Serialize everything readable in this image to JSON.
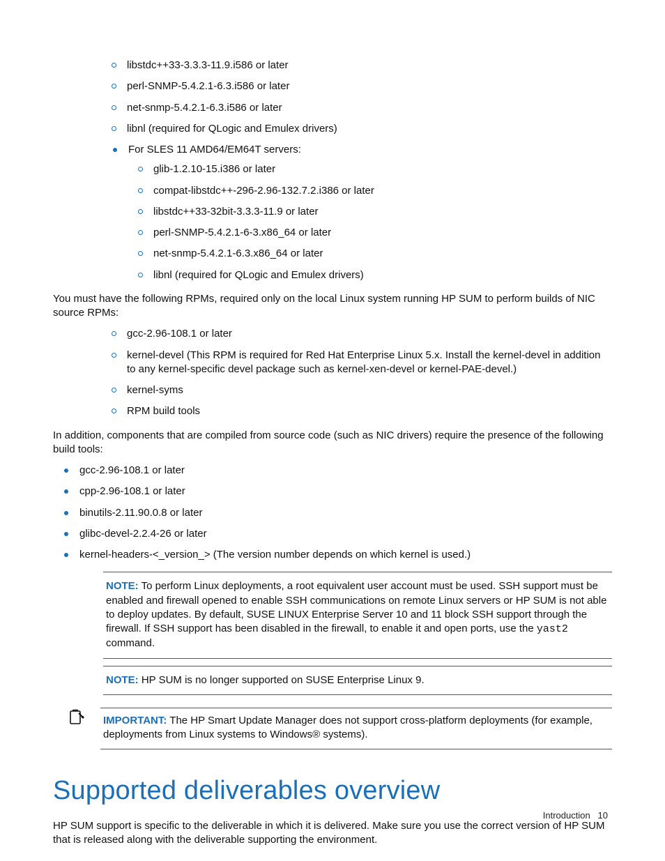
{
  "lists": {
    "circle_a": [
      "libstdc++33-3.3.3-11.9.i586 or later",
      "perl-SNMP-5.4.2.1-6.3.i586 or later",
      "net-snmp-5.4.2.1-6.3.i586 or later",
      "libnl (required for QLogic and Emulex drivers)"
    ],
    "bullet_intro": "For SLES 11 AMD64/EM64T servers:",
    "circle_b": [
      "glib-1.2.10-15.i386 or later",
      "compat-libstdc++-296-2.96-132.7.2.i386 or later",
      "libstdc++33-32bit-3.3.3-11.9 or later",
      "perl-SNMP-5.4.2.1-6-3.x86_64 or later",
      "net-snmp-5.4.2.1-6.3.x86_64 or later",
      "libnl (required for QLogic and Emulex drivers)"
    ],
    "para_rpms": "You must have the following RPMs, required only on the local Linux system running HP SUM to perform builds of NIC source RPMs:",
    "circle_c": [
      "gcc-2.96-108.1 or later",
      "kernel-devel (This RPM is required for Red Hat Enterprise Linux 5.x. Install the kernel-devel in addition to any kernel-specific devel package such as kernel-xen-devel or kernel-PAE-devel.)",
      "kernel-syms",
      "RPM build tools"
    ],
    "para_compiled": "In addition, components that are compiled from source code (such as NIC drivers) require the presence of the following build tools:",
    "bullet_d": [
      "gcc-2.96-108.1 or later",
      "cpp-2.96-108.1 or later",
      "binutils-2.11.90.0.8 or later",
      "glibc-devel-2.2.4-26 or later",
      "kernel-headers-<_version_> (The version number depends on which kernel is used.)"
    ]
  },
  "notes": {
    "note1_label": "NOTE:",
    "note1_body_a": " To perform Linux deployments, a root equivalent user account must be used. SSH support must be enabled and firewall opened to enable SSH communications on remote Linux servers or HP SUM is not able to deploy updates. By default, SUSE LINUX Enterprise Server 10 and 11 block SSH support through the firewall. If SSH support has been disabled in the firewall, to enable it and open ports, use the ",
    "note1_cmd": "yast2",
    "note1_body_b": " command.",
    "note2_label": "NOTE:",
    "note2_body": " HP SUM is no longer supported on SUSE Enterprise Linux 9.",
    "important_label": "IMPORTANT:",
    "important_body": " The HP Smart Update Manager does not support cross-platform deployments (for example, deployments from Linux systems to Windows® systems)."
  },
  "heading": "Supported deliverables overview",
  "heading_para": "HP SUM support is specific to the deliverable in which it is delivered. Make sure you use the correct version of HP SUM that is released along with the deliverable supporting the environment.",
  "footer": {
    "section": "Introduction",
    "page": "10"
  }
}
